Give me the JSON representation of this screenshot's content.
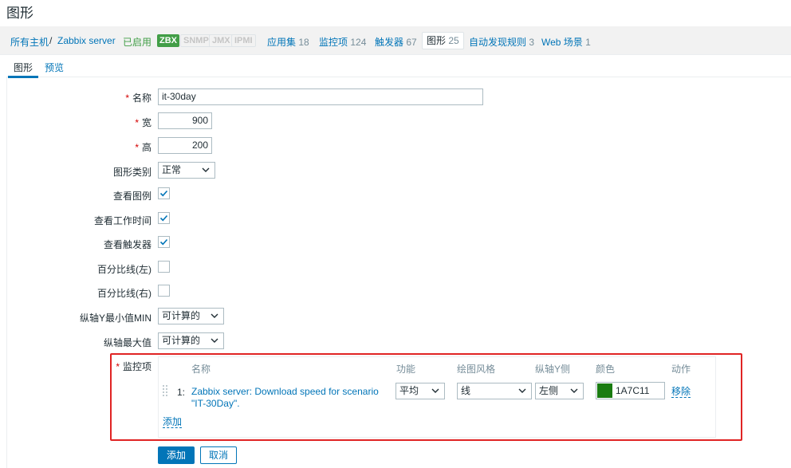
{
  "page": {
    "title": "图形"
  },
  "breadcrumb": {
    "all_hosts": "所有主机",
    "separator": "/",
    "host": "Zabbix server",
    "status": "已启用",
    "tags": [
      {
        "label": "ZBX",
        "state": "active"
      },
      {
        "label": "SNMP",
        "state": "inactive"
      },
      {
        "label": "JMX",
        "state": "inactive"
      },
      {
        "label": "IPMI",
        "state": "inactive"
      }
    ],
    "nav": [
      {
        "label": "应用集",
        "count": "18"
      },
      {
        "label": "监控项",
        "count": "124"
      },
      {
        "label": "触发器",
        "count": "67"
      },
      {
        "label": "图形",
        "count": "25"
      },
      {
        "label": "自动发现规则",
        "count": "3"
      },
      {
        "label": "Web 场景",
        "count": "1"
      }
    ]
  },
  "tabs": [
    {
      "label": "图形",
      "active": true
    },
    {
      "label": "预览",
      "active": false
    }
  ],
  "form": {
    "name": {
      "label": "名称",
      "value": "it-30day",
      "required": true
    },
    "width": {
      "label": "宽",
      "value": "900",
      "required": true
    },
    "height": {
      "label": "高",
      "value": "200",
      "required": true
    },
    "graph_type": {
      "label": "图形类别",
      "value": "正常"
    },
    "show_legend": {
      "label": "查看图例",
      "checked": true
    },
    "show_working_time": {
      "label": "查看工作时间",
      "checked": true
    },
    "show_triggers": {
      "label": "查看触发器",
      "checked": true
    },
    "percentile_left": {
      "label": "百分比线(左)",
      "checked": false
    },
    "percentile_right": {
      "label": "百分比线(右)",
      "checked": false
    },
    "y_min": {
      "label": "纵轴Y最小值MIN",
      "value": "可计算的"
    },
    "y_max": {
      "label": "纵轴最大值",
      "value": "可计算的"
    },
    "items": {
      "label": "监控项",
      "required": true,
      "columns": [
        "名称",
        "功能",
        "绘图风格",
        "纵轴Y侧",
        "颜色",
        "动作"
      ],
      "rows": [
        {
          "index": "1:",
          "name": "Zabbix server: Download speed for scenario \"IT-30Day\".",
          "function": "平均",
          "draw_style": "线",
          "y_axis_side": "左侧",
          "color": "1A7C11",
          "color_hex": "#1a7c11",
          "action": "移除"
        }
      ],
      "add_label": "添加"
    }
  },
  "buttons": {
    "add": "添加",
    "cancel": "取消"
  },
  "colors": {
    "accent": "#0275b8",
    "enabled": "#429e47",
    "required": "#d40000",
    "highlight_box": "#e02424"
  },
  "icons": [
    "chevron-down-icon",
    "checkmark-icon",
    "drag-handle-icon"
  ]
}
